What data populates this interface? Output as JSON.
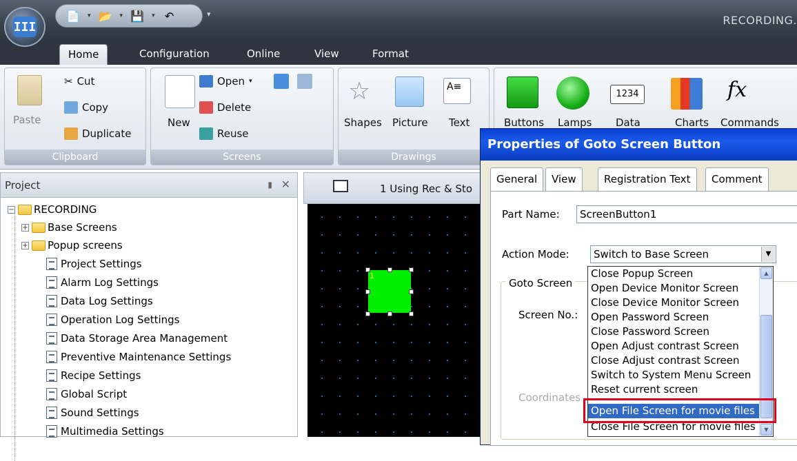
{
  "window": {
    "title": "RECORDING.",
    "app_logo": "III"
  },
  "ribbon_tabs": [
    "Home",
    "Configuration",
    "Online",
    "View",
    "Format"
  ],
  "clipboard": {
    "paste": "Paste",
    "cut": "Cut",
    "copy": "Copy",
    "duplicate": "Duplicate",
    "label": "Clipboard"
  },
  "screens": {
    "new": "New",
    "open": "Open",
    "delete": "Delete",
    "reuse": "Reuse",
    "label": "Screens"
  },
  "drawings": {
    "shapes": "Shapes",
    "picture": "Picture",
    "text": "Text",
    "label": "Drawings"
  },
  "parts": {
    "buttons": "Buttons",
    "lamps": "Lamps",
    "data": "Data",
    "data_icon": "1234",
    "charts": "Charts",
    "commands": "Commands",
    "fx": "fx"
  },
  "project": {
    "title": "Project",
    "root": "RECORDING",
    "folders": [
      "Base Screens",
      "Popup screens"
    ],
    "items": [
      "Project Settings",
      "Alarm Log Settings",
      "Data Log Settings",
      "Operation Log Settings",
      "Data Storage Area Management",
      "Preventive Maintenance Settings",
      "Recipe Settings",
      "Global Script",
      "Sound Settings",
      "Multimedia Settings"
    ]
  },
  "editor": {
    "tab_title": "1 Using Rec & Sto",
    "button_number": "1"
  },
  "dialog": {
    "title": "Properties of Goto Screen Button",
    "tabs": [
      "General",
      "View",
      "Registration Text",
      "Comment"
    ],
    "part_name_label": "Part Name:",
    "part_name_value": "ScreenButton1",
    "action_mode_label": "Action Mode:",
    "action_mode_value": "Switch to Base Screen",
    "goto_group_label": "Goto Screen",
    "screen_no_label": "Screen No.:",
    "coordinates_label": "Coordinates",
    "options": [
      "Close Popup Screen",
      "Open Device Monitor Screen",
      "Close Device Monitor Screen",
      "Open Password Screen",
      "Close Password Screen",
      "Open Adjust contrast Screen",
      "Close Adjust contrast Screen",
      "Switch to System Menu Screen",
      "Reset current screen",
      "Open File Screen for movie files",
      "Close File Screen for movie files"
    ],
    "selected_option": "Open File Screen for movie files"
  }
}
